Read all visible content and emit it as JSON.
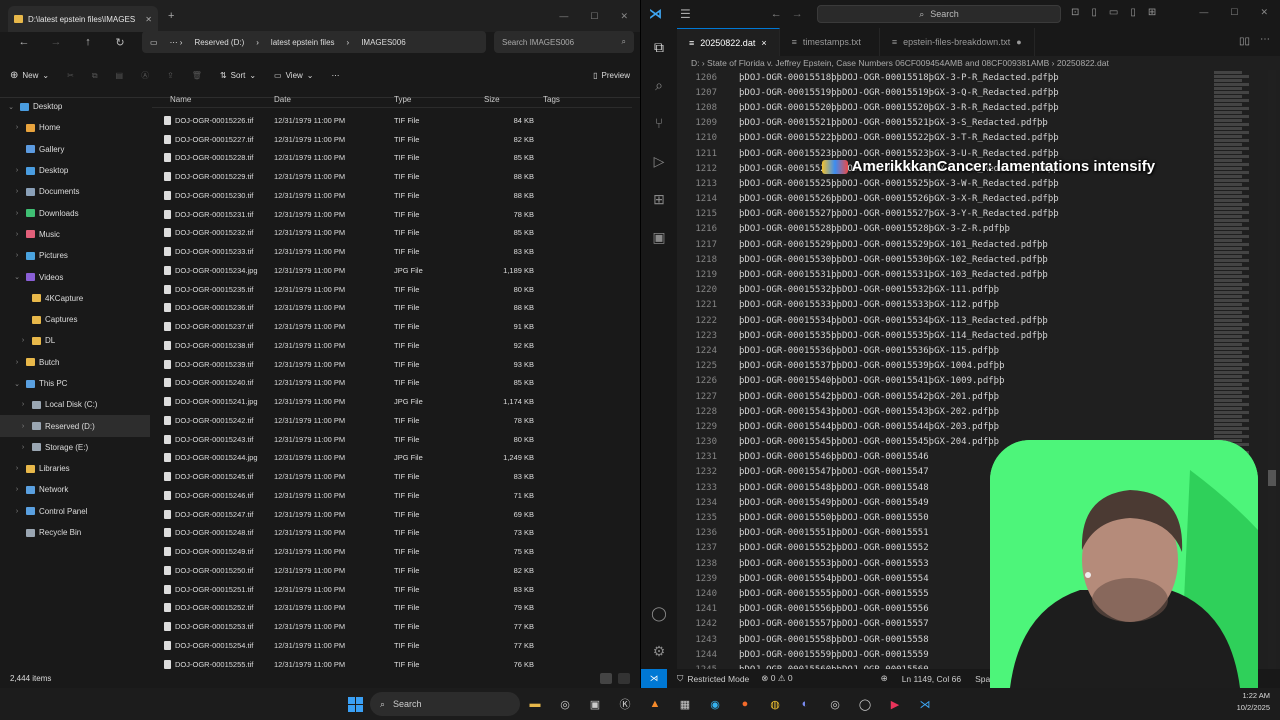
{
  "explorer": {
    "tab_title": "D:\\latest epstein files\\IMAGES",
    "address": {
      "drive": "Reserved (D:)",
      "folder": "latest epstein files",
      "sub": "IMAGES006"
    },
    "search_placeholder": "Search IMAGES006",
    "cmd": {
      "new": "New",
      "sort": "Sort",
      "view": "View",
      "preview": "Preview"
    },
    "nav_items": [
      {
        "label": "Desktop",
        "level": 0,
        "chev": "v",
        "color": "#4a9de0",
        "sel": false
      },
      {
        "label": "Home",
        "level": 1,
        "chev": ">",
        "color": "#e8a33d",
        "sel": false
      },
      {
        "label": "Gallery",
        "level": 1,
        "chev": "",
        "color": "#5c9be0",
        "sel": false
      },
      {
        "label": "Desktop",
        "level": 1,
        "chev": ">",
        "color": "#4a9de0",
        "sel": false
      },
      {
        "label": "Documents",
        "level": 1,
        "chev": ">",
        "color": "#8aa0b8",
        "sel": false
      },
      {
        "label": "Downloads",
        "level": 1,
        "chev": ">",
        "color": "#3fbf73",
        "sel": false
      },
      {
        "label": "Music",
        "level": 1,
        "chev": ">",
        "color": "#e2607a",
        "sel": false
      },
      {
        "label": "Pictures",
        "level": 1,
        "chev": ">",
        "color": "#4aa3df",
        "sel": false
      },
      {
        "label": "Videos",
        "level": 1,
        "chev": "v",
        "color": "#8a5fd6",
        "sel": false
      },
      {
        "label": "4KCapture",
        "level": 2,
        "chev": "",
        "color": "#e8b84a",
        "sel": false
      },
      {
        "label": "Captures",
        "level": 2,
        "chev": "",
        "color": "#e8b84a",
        "sel": false
      },
      {
        "label": "DL",
        "level": 2,
        "chev": ">",
        "color": "#e8b84a",
        "sel": false
      },
      {
        "label": "Butch",
        "level": 1,
        "chev": ">",
        "color": "#e8b84a",
        "sel": false
      },
      {
        "label": "This PC",
        "level": 1,
        "chev": "v",
        "color": "#5aa0e0",
        "sel": false
      },
      {
        "label": "Local Disk (C:)",
        "level": 2,
        "chev": ">",
        "color": "#9aa6b2",
        "sel": false
      },
      {
        "label": "Reserved (D:)",
        "level": 2,
        "chev": ">",
        "color": "#9aa6b2",
        "sel": true
      },
      {
        "label": "Storage (E:)",
        "level": 2,
        "chev": ">",
        "color": "#9aa6b2",
        "sel": false
      },
      {
        "label": "Libraries",
        "level": 1,
        "chev": ">",
        "color": "#e8b84a",
        "sel": false
      },
      {
        "label": "Network",
        "level": 1,
        "chev": ">",
        "color": "#5aa0e0",
        "sel": false
      },
      {
        "label": "Control Panel",
        "level": 1,
        "chev": ">",
        "color": "#5aa0e0",
        "sel": false
      },
      {
        "label": "Recycle Bin",
        "level": 1,
        "chev": "",
        "color": "#9aa6b2",
        "sel": false
      }
    ],
    "columns": {
      "name": "Name",
      "date": "Date",
      "type": "Type",
      "size": "Size",
      "tags": "Tags"
    },
    "files": [
      {
        "name": "DOJ-OGR-00015226.tif",
        "date": "12/31/1979 11:00 PM",
        "type": "TIF File",
        "size": "84 KB"
      },
      {
        "name": "DOJ-OGR-00015227.tif",
        "date": "12/31/1979 11:00 PM",
        "type": "TIF File",
        "size": "82 KB"
      },
      {
        "name": "DOJ-OGR-00015228.tif",
        "date": "12/31/1979 11:00 PM",
        "type": "TIF File",
        "size": "85 KB"
      },
      {
        "name": "DOJ-OGR-00015229.tif",
        "date": "12/31/1979 11:00 PM",
        "type": "TIF File",
        "size": "88 KB"
      },
      {
        "name": "DOJ-OGR-00015230.tif",
        "date": "12/31/1979 11:00 PM",
        "type": "TIF File",
        "size": "88 KB"
      },
      {
        "name": "DOJ-OGR-00015231.tif",
        "date": "12/31/1979 11:00 PM",
        "type": "TIF File",
        "size": "78 KB"
      },
      {
        "name": "DOJ-OGR-00015232.tif",
        "date": "12/31/1979 11:00 PM",
        "type": "TIF File",
        "size": "85 KB"
      },
      {
        "name": "DOJ-OGR-00015233.tif",
        "date": "12/31/1979 11:00 PM",
        "type": "TIF File",
        "size": "83 KB"
      },
      {
        "name": "DOJ-OGR-00015234.jpg",
        "date": "12/31/1979 11:00 PM",
        "type": "JPG File",
        "size": "1,189 KB"
      },
      {
        "name": "DOJ-OGR-00015235.tif",
        "date": "12/31/1979 11:00 PM",
        "type": "TIF File",
        "size": "80 KB"
      },
      {
        "name": "DOJ-OGR-00015236.tif",
        "date": "12/31/1979 11:00 PM",
        "type": "TIF File",
        "size": "88 KB"
      },
      {
        "name": "DOJ-OGR-00015237.tif",
        "date": "12/31/1979 11:00 PM",
        "type": "TIF File",
        "size": "91 KB"
      },
      {
        "name": "DOJ-OGR-00015238.tif",
        "date": "12/31/1979 11:00 PM",
        "type": "TIF File",
        "size": "92 KB"
      },
      {
        "name": "DOJ-OGR-00015239.tif",
        "date": "12/31/1979 11:00 PM",
        "type": "TIF File",
        "size": "93 KB"
      },
      {
        "name": "DOJ-OGR-00015240.tif",
        "date": "12/31/1979 11:00 PM",
        "type": "TIF File",
        "size": "85 KB"
      },
      {
        "name": "DOJ-OGR-00015241.jpg",
        "date": "12/31/1979 11:00 PM",
        "type": "JPG File",
        "size": "1,174 KB"
      },
      {
        "name": "DOJ-OGR-00015242.tif",
        "date": "12/31/1979 11:00 PM",
        "type": "TIF File",
        "size": "78 KB"
      },
      {
        "name": "DOJ-OGR-00015243.tif",
        "date": "12/31/1979 11:00 PM",
        "type": "TIF File",
        "size": "80 KB"
      },
      {
        "name": "DOJ-OGR-00015244.jpg",
        "date": "12/31/1979 11:00 PM",
        "type": "JPG File",
        "size": "1,249 KB"
      },
      {
        "name": "DOJ-OGR-00015245.tif",
        "date": "12/31/1979 11:00 PM",
        "type": "TIF File",
        "size": "83 KB"
      },
      {
        "name": "DOJ-OGR-00015246.tif",
        "date": "12/31/1979 11:00 PM",
        "type": "TIF File",
        "size": "71 KB"
      },
      {
        "name": "DOJ-OGR-00015247.tif",
        "date": "12/31/1979 11:00 PM",
        "type": "TIF File",
        "size": "69 KB"
      },
      {
        "name": "DOJ-OGR-00015248.tif",
        "date": "12/31/1979 11:00 PM",
        "type": "TIF File",
        "size": "73 KB"
      },
      {
        "name": "DOJ-OGR-00015249.tif",
        "date": "12/31/1979 11:00 PM",
        "type": "TIF File",
        "size": "75 KB"
      },
      {
        "name": "DOJ-OGR-00015250.tif",
        "date": "12/31/1979 11:00 PM",
        "type": "TIF File",
        "size": "82 KB"
      },
      {
        "name": "DOJ-OGR-00015251.tif",
        "date": "12/31/1979 11:00 PM",
        "type": "TIF File",
        "size": "83 KB"
      },
      {
        "name": "DOJ-OGR-00015252.tif",
        "date": "12/31/1979 11:00 PM",
        "type": "TIF File",
        "size": "79 KB"
      },
      {
        "name": "DOJ-OGR-00015253.tif",
        "date": "12/31/1979 11:00 PM",
        "type": "TIF File",
        "size": "77 KB"
      },
      {
        "name": "DOJ-OGR-00015254.tif",
        "date": "12/31/1979 11:00 PM",
        "type": "TIF File",
        "size": "77 KB"
      },
      {
        "name": "DOJ-OGR-00015255.tif",
        "date": "12/31/1979 11:00 PM",
        "type": "TIF File",
        "size": "76 KB"
      }
    ],
    "status": "2,444 items"
  },
  "vscode": {
    "search": "Search",
    "tabs": [
      {
        "label": "20250822.dat",
        "active": true,
        "mark": "×"
      },
      {
        "label": "timestamps.txt",
        "active": false,
        "mark": ""
      },
      {
        "label": "epstein-files-breakdown.txt",
        "active": false,
        "mark": "●"
      }
    ],
    "breadcrumb": "D: › State of Florida v. Jeffrey Epstein, Case Numbers 06CF009454AMB and 08CF009381AMB › 20250822.dat",
    "lines": [
      {
        "n": "1206",
        "t": "þDOJ-OGR-00015518þþDOJ-OGR-00015518þGX-3-P-R_Redacted.pdfþþ"
      },
      {
        "n": "1207",
        "t": "þDOJ-OGR-00015519þþDOJ-OGR-00015519þGX-3-Q-R_Redacted.pdfþþ"
      },
      {
        "n": "1208",
        "t": "þDOJ-OGR-00015520þþDOJ-OGR-00015520þGX-3-R-R_Redacted.pdfþþ"
      },
      {
        "n": "1209",
        "t": "þDOJ-OGR-00015521þþDOJ-OGR-00015521þGX-3-S_Redacted.pdfþþ"
      },
      {
        "n": "1210",
        "t": "þDOJ-OGR-00015522þþDOJ-OGR-00015522þGX-3-T-R_Redacted.pdfþþ"
      },
      {
        "n": "1211",
        "t": "þDOJ-OGR-00015523þþDOJ-OGR-00015523þGX-3-U-R_Redacted.pdfþþ"
      },
      {
        "n": "1212",
        "t": "þDOJ-OGR-00015524þþDOJ-OGR-00015524þGX-3-V-R_Redacted.pdfþþ"
      },
      {
        "n": "1213",
        "t": "þDOJ-OGR-00015525þþDOJ-OGR-00015525þGX-3-W-R_Redacted.pdfþþ"
      },
      {
        "n": "1214",
        "t": "þDOJ-OGR-00015526þþDOJ-OGR-00015526þGX-3-X-R_Redacted.pdfþþ"
      },
      {
        "n": "1215",
        "t": "þDOJ-OGR-00015527þþDOJ-OGR-00015527þGX-3-Y-R_Redacted.pdfþþ"
      },
      {
        "n": "1216",
        "t": "þDOJ-OGR-00015528þþDOJ-OGR-00015528þGX-3-Z-R.pdfþþ"
      },
      {
        "n": "1217",
        "t": "þDOJ-OGR-00015529þþDOJ-OGR-00015529þGX-101_Redacted.pdfþþ"
      },
      {
        "n": "1218",
        "t": "þDOJ-OGR-00015530þþDOJ-OGR-00015530þGX-102_Redacted.pdfþþ"
      },
      {
        "n": "1219",
        "t": "þDOJ-OGR-00015531þþDOJ-OGR-00015531þGX-103_Redacted.pdfþþ"
      },
      {
        "n": "1220",
        "t": "þDOJ-OGR-00015532þþDOJ-OGR-00015532þGX-111.pdfþþ"
      },
      {
        "n": "1221",
        "t": "þDOJ-OGR-00015533þþDOJ-OGR-00015533þGX-112.pdfþþ"
      },
      {
        "n": "1222",
        "t": "þDOJ-OGR-00015534þþDOJ-OGR-00015534þGX-113_Redacted.pdfþþ"
      },
      {
        "n": "1223",
        "t": "þDOJ-OGR-00015535þþDOJ-OGR-00015535þGX-114_Redacted.pdfþþ"
      },
      {
        "n": "1224",
        "t": "þDOJ-OGR-00015536þþDOJ-OGR-00015536þGX-115.pdfþþ"
      },
      {
        "n": "1225",
        "t": "þDOJ-OGR-00015537þþDOJ-OGR-00015539þGX-1004.pdfþþ"
      },
      {
        "n": "1226",
        "t": "þDOJ-OGR-00015540þþDOJ-OGR-00015541þGX-1009.pdfþþ"
      },
      {
        "n": "1227",
        "t": "þDOJ-OGR-00015542þþDOJ-OGR-00015542þGX-201.pdfþþ"
      },
      {
        "n": "1228",
        "t": "þDOJ-OGR-00015543þþDOJ-OGR-00015543þGX-202.pdfþþ"
      },
      {
        "n": "1229",
        "t": "þDOJ-OGR-00015544þþDOJ-OGR-00015544þGX-203.pdfþþ"
      },
      {
        "n": "1230",
        "t": "þDOJ-OGR-00015545þþDOJ-OGR-00015545þGX-204.pdfþþ"
      },
      {
        "n": "1231",
        "t": "þDOJ-OGR-00015546þþDOJ-OGR-00015546"
      },
      {
        "n": "1232",
        "t": "þDOJ-OGR-00015547þþDOJ-OGR-00015547"
      },
      {
        "n": "1233",
        "t": "þDOJ-OGR-00015548þþDOJ-OGR-00015548"
      },
      {
        "n": "1234",
        "t": "þDOJ-OGR-00015549þþDOJ-OGR-00015549"
      },
      {
        "n": "1235",
        "t": "þDOJ-OGR-00015550þþDOJ-OGR-00015550"
      },
      {
        "n": "1236",
        "t": "þDOJ-OGR-00015551þþDOJ-OGR-00015551"
      },
      {
        "n": "1237",
        "t": "þDOJ-OGR-00015552þþDOJ-OGR-00015552"
      },
      {
        "n": "1238",
        "t": "þDOJ-OGR-00015553þþDOJ-OGR-00015553"
      },
      {
        "n": "1239",
        "t": "þDOJ-OGR-00015554þþDOJ-OGR-00015554"
      },
      {
        "n": "1240",
        "t": "þDOJ-OGR-00015555þþDOJ-OGR-00015555"
      },
      {
        "n": "1241",
        "t": "þDOJ-OGR-00015556þþDOJ-OGR-00015556"
      },
      {
        "n": "1242",
        "t": "þDOJ-OGR-00015557þþDOJ-OGR-00015557"
      },
      {
        "n": "1243",
        "t": "þDOJ-OGR-00015558þþDOJ-OGR-00015558"
      },
      {
        "n": "1244",
        "t": "þDOJ-OGR-00015559þþDOJ-OGR-00015559"
      },
      {
        "n": "1245",
        "t": "þDOJ-OGR-00015560þþDOJ-OGR-00015560"
      }
    ],
    "status": {
      "mode": "Restricted Mode",
      "problems": "⊗ 0 ⚠ 0",
      "position": "Ln 1149, Col 66",
      "spaces": "Spac"
    }
  },
  "overlay_text": "AmerikkkanCancer: lamentations intensify",
  "taskbar": {
    "search": "Search",
    "time": "1:22 AM",
    "date": "10/2/2025"
  }
}
